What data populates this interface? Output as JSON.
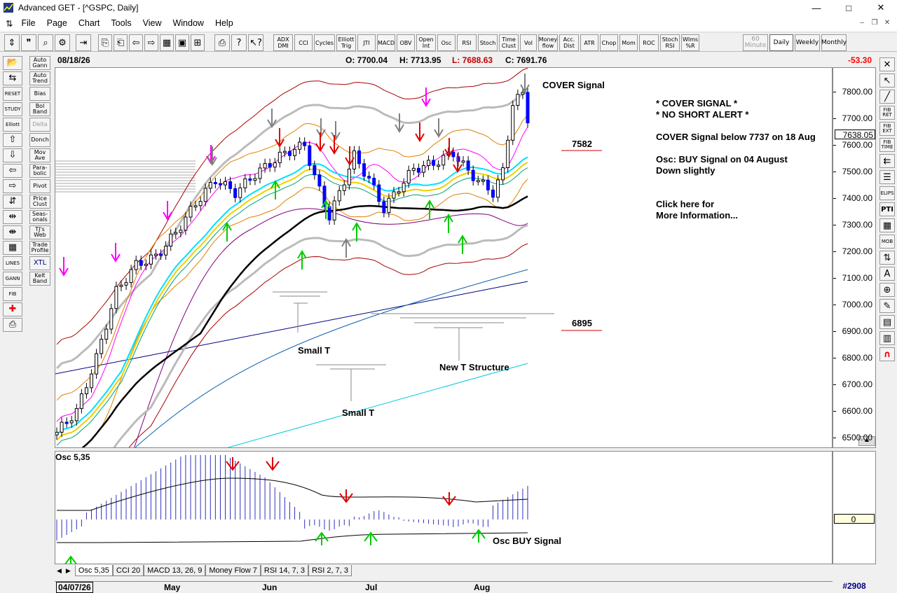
{
  "window": {
    "title": "Advanced GET - [^GSPC, Daily]",
    "minimize": "—",
    "maximize": "□",
    "close": "✕"
  },
  "menu": [
    "File",
    "Page",
    "Chart",
    "Tools",
    "View",
    "Window",
    "Help"
  ],
  "toolbar": {
    "studies": [
      "ADX DMI",
      "CCI",
      "Cycles",
      "Elliott Trig",
      "JTI",
      "MACD",
      "OBV",
      "Open Int",
      "Osc",
      "RSI",
      "Stoch",
      "Time Clust",
      "Vol",
      "Money flow",
      "Acc. Dist",
      "ATR",
      "Chop",
      "Mom",
      "ROC",
      "Stoch RSI",
      "Wlms %R"
    ],
    "periods": [
      "60 Minute",
      "Daily",
      "Weekly",
      "Monthly"
    ]
  },
  "leftbar": [
    "Auto Gann",
    "Auto Trend",
    "Bias",
    "Bol Band",
    "Delta",
    "Donch",
    "Mov Ave",
    "Para-bolic",
    "Pivot",
    "Price Clust",
    "Seas-onals",
    "TJ's Web",
    "Trade Profile",
    "XTL",
    "Kelt Band",
    "RESET",
    "STUDY",
    "Elliott",
    "LINES",
    "GANN",
    "FIB"
  ],
  "rightbar": [
    "FIB RET",
    "FIB EXT",
    "FIB TIME",
    "ELIPS",
    "PTI",
    "MOB"
  ],
  "info": {
    "date": "08/18/26",
    "open": "O: 7700.04",
    "high": "H: 7713.95",
    "low": "L: 7688.63",
    "close": "C: 7691.76",
    "change": "-53.30"
  },
  "annotations": {
    "cover_signal": "COVER Signal",
    "cover_title": "* COVER SIGNAL *",
    "no_short": "* NO SHORT ALERT *",
    "cover_detail": "COVER Signal below 7737 on 18 Aug",
    "osc_detail": "Osc: BUY Signal on 04 August",
    "down": "Down slightly",
    "click1": "Click here for",
    "click2": "More Information...",
    "level_high": "7582",
    "level_low": "6895",
    "small_t_1": "Small T",
    "small_t_2": "Small T",
    "new_t": "New T Structure",
    "osc_title": "Osc 5,35",
    "osc_buy": "Osc BUY Signal"
  },
  "price_axis": {
    "labels": [
      "7800.00",
      "7700.00",
      "7600.00",
      "7500.00",
      "7400.00",
      "7300.00",
      "7200.00",
      "7100.00",
      "7000.00",
      "6900.00",
      "6800.00",
      "6700.00",
      "6600.00",
      "6500.00"
    ],
    "current": "7638.05"
  },
  "osc_axis": {
    "zero": "0"
  },
  "tabs": [
    "Osc 5,35",
    "CCI 20",
    "MACD 13, 26, 9",
    "Money Flow 7",
    "RSI 14, 7, 3",
    "RSI 2, 7, 3"
  ],
  "dates": {
    "start": "04/07/26",
    "months": [
      "May",
      "Jun",
      "Jul",
      "Aug"
    ]
  },
  "bar_number": "#2908",
  "colors": {
    "up_bar": "#0000ff",
    "down_bar": "#000000",
    "sell_arrow": "#e00000",
    "buy_arrow": "#00cc00",
    "neutral_arrow": "#808080",
    "alert_arrow": "#ff00ff",
    "change": "#ff0000"
  }
}
